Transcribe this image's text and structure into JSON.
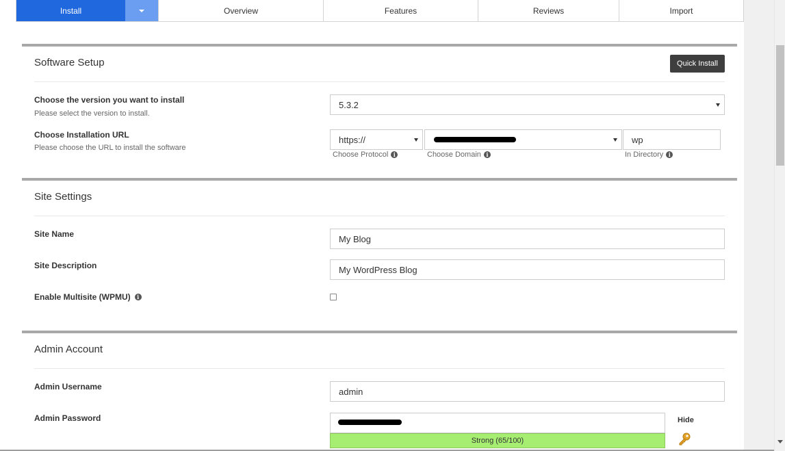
{
  "tabs": {
    "install": "Install",
    "overview": "Overview",
    "features": "Features",
    "reviews": "Reviews",
    "import": "Import"
  },
  "software_setup": {
    "title": "Software Setup",
    "quick_install": "Quick Install",
    "version_label": "Choose the version you want to install",
    "version_sub": "Please select the version to install.",
    "version_value": "5.3.2",
    "url_label": "Choose Installation URL",
    "url_sub": "Please choose the URL to install the software",
    "protocol_value": "https://",
    "directory_value": "wp",
    "protocol_hint": "Choose Protocol",
    "domain_hint": "Choose Domain",
    "directory_hint": "In Directory"
  },
  "site_settings": {
    "title": "Site Settings",
    "site_name_label": "Site Name",
    "site_name_value": "My Blog",
    "site_desc_label": "Site Description",
    "site_desc_value": "My WordPress Blog",
    "multisite_label": "Enable Multisite (WPMU)"
  },
  "admin_account": {
    "title": "Admin Account",
    "username_label": "Admin Username",
    "username_value": "admin",
    "password_label": "Admin Password",
    "strength": "Strong (65/100)",
    "hide": "Hide"
  },
  "colors": {
    "accent": "#1f68dd",
    "strength_bar": "#a6ee71"
  }
}
